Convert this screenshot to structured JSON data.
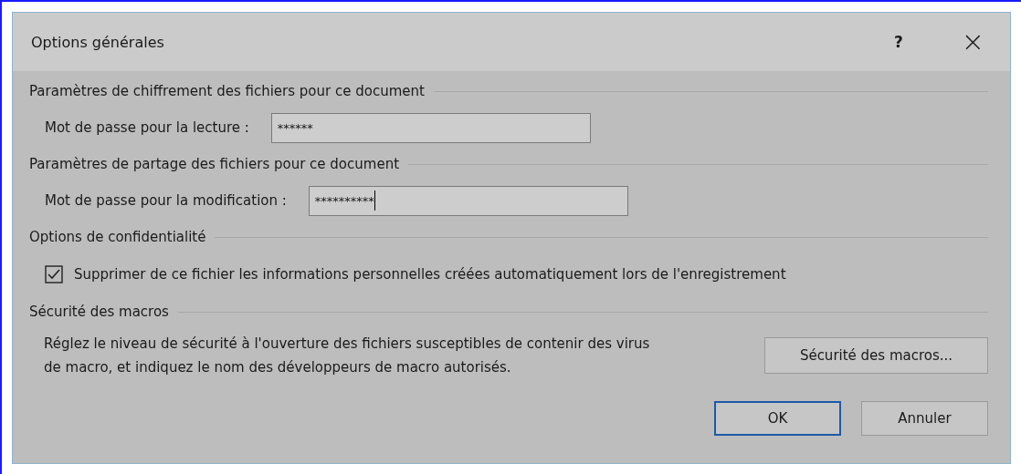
{
  "window": {
    "title": "Options générales",
    "help": "?",
    "close": "×"
  },
  "sections": [
    {
      "kind": "password",
      "heading": "Paramètres de chiffrement des fichiers pour ce document",
      "label": "Mot de passe pour la lecture :",
      "value": "******",
      "focused": false
    },
    {
      "kind": "password",
      "heading": "Paramètres de partage des fichiers pour ce document",
      "label": "Mot de passe pour la modification :",
      "value": "**********",
      "focused": true
    },
    {
      "kind": "checkbox",
      "heading": "Options de confidentialité",
      "label": "Supprimer de ce fichier les informations personnelles créées automatiquement lors de l'enregistrement",
      "checked": true
    },
    {
      "kind": "macro",
      "heading": "Sécurité des macros",
      "description": "Réglez le niveau de sécurité à l'ouverture des fichiers susceptibles de contenir des virus de macro, et indiquez le nom des développeurs de macro autorisés.",
      "button": "Sécurité des macros..."
    }
  ],
  "buttons": [
    {
      "label": "OK",
      "default": true
    },
    {
      "label": "Annuler",
      "default": false
    }
  ]
}
